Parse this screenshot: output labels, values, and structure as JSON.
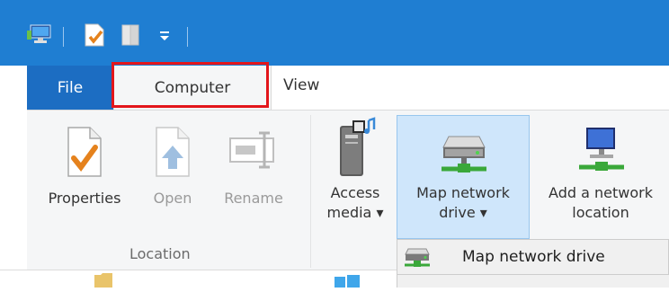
{
  "tabs": {
    "file": "File",
    "computer": "Computer",
    "view": "View"
  },
  "ribbon": {
    "location_group": {
      "label": "Location",
      "properties": "Properties",
      "open": "Open",
      "rename": "Rename"
    },
    "network_group": {
      "access_media_l1": "Access",
      "access_media_l2": "media ▾",
      "map_drive_l1": "Map network",
      "map_drive_l2": "drive ▾",
      "add_location_l1": "Add a network",
      "add_location_l2": "location"
    }
  },
  "dropdown": {
    "item": "Map network drive"
  },
  "colors": {
    "titlebar": "#1f7ed2",
    "file_tab": "#1c6dc2",
    "highlight": "#e3161b",
    "selected_button": "#cfe6fb"
  }
}
